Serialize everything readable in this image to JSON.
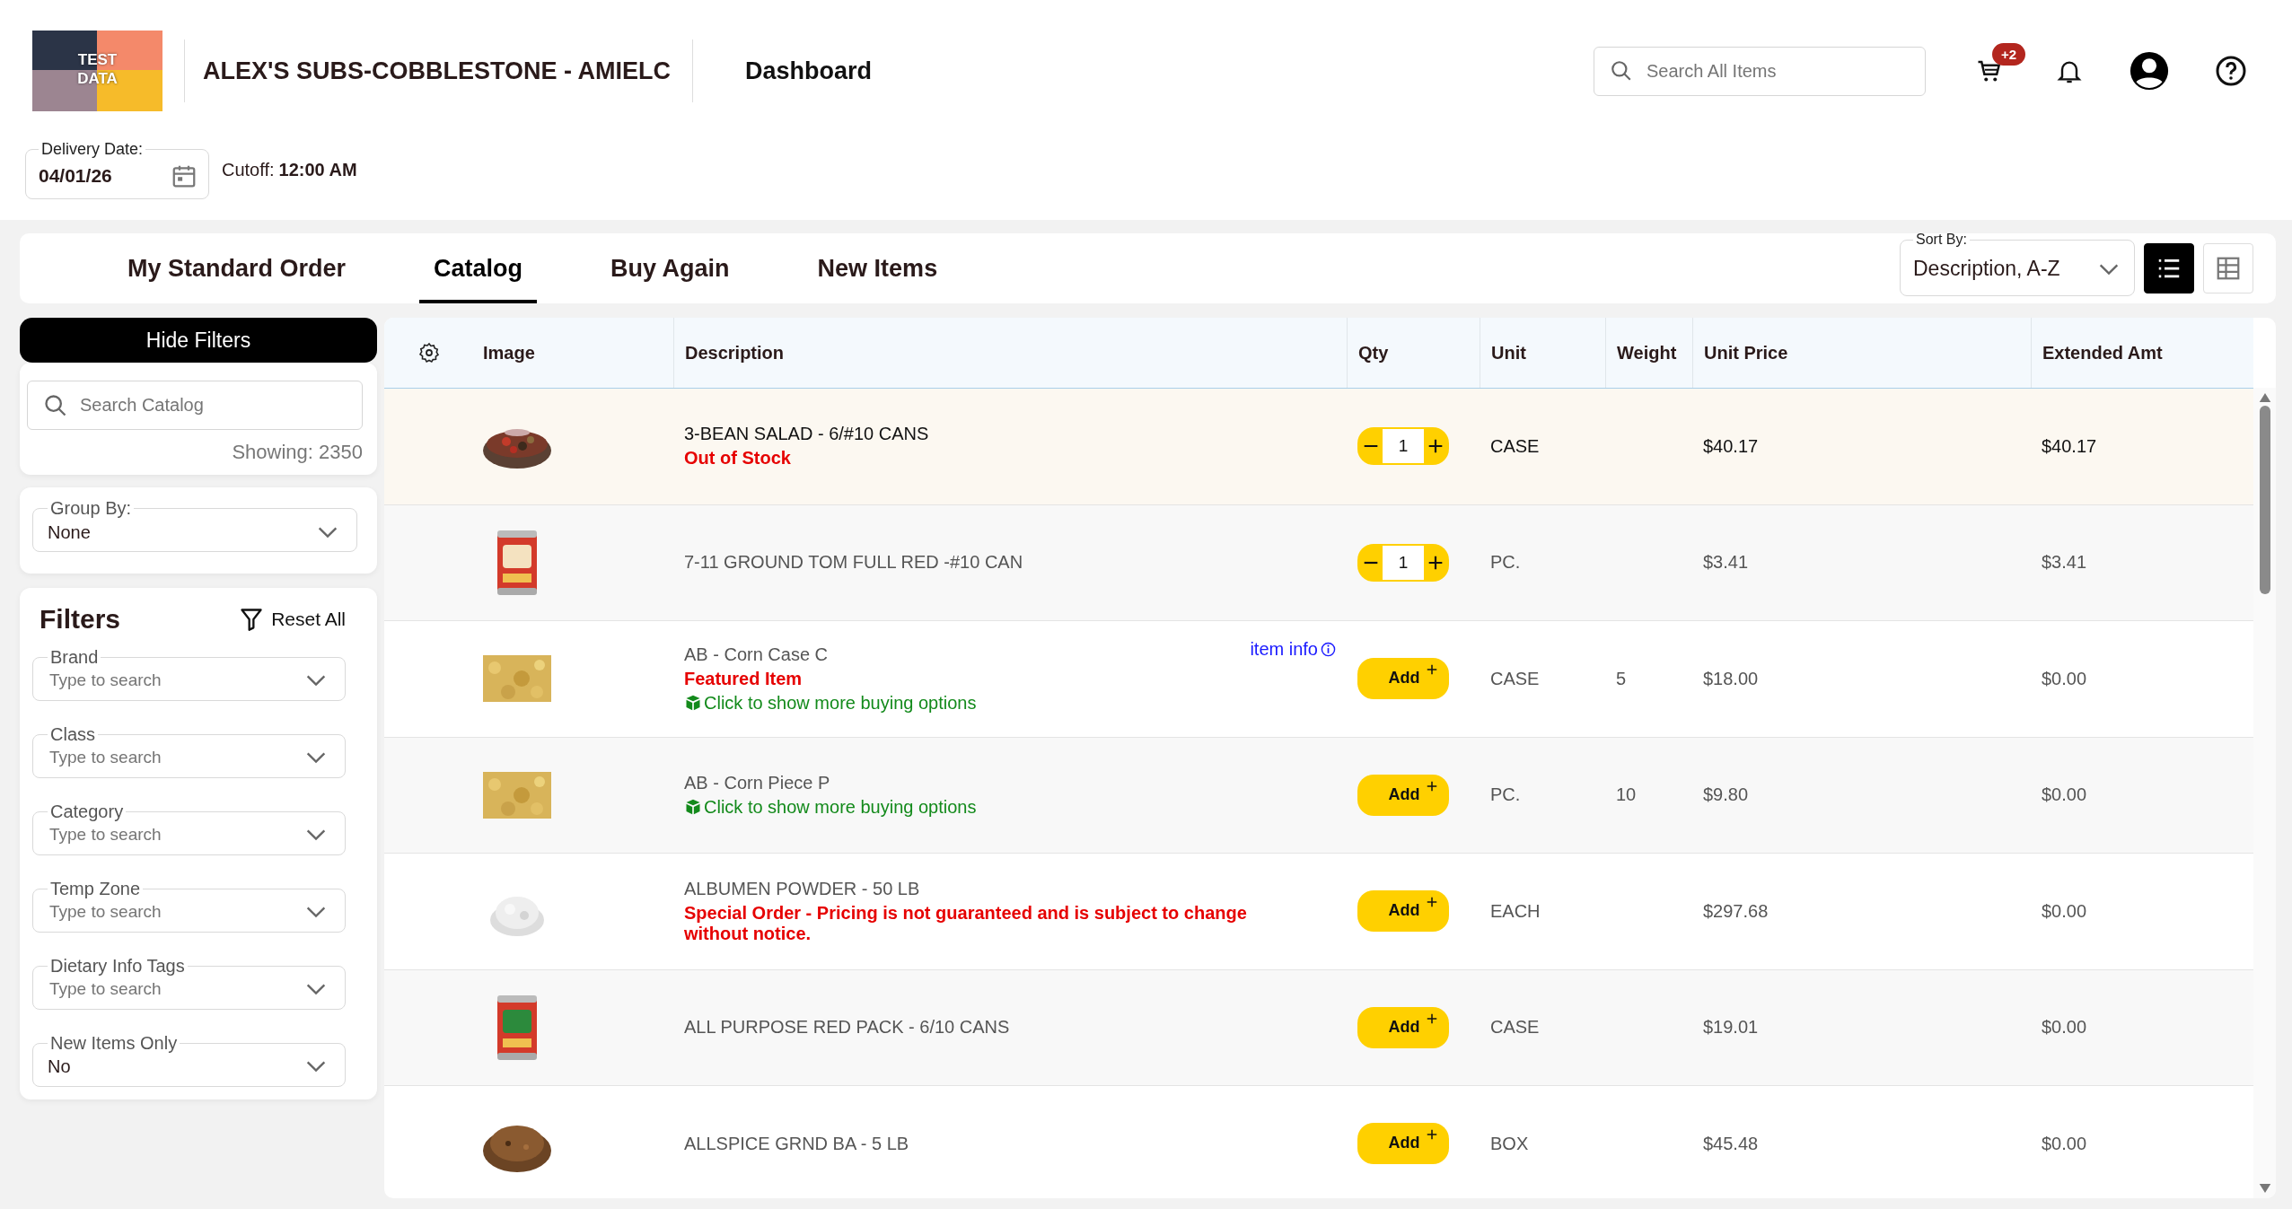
{
  "header": {
    "logo_lines": [
      "TEST",
      "DATA"
    ],
    "store": "ALEX'S SUBS-COBBLESTONE - AMIELC",
    "nav_link": "Dashboard",
    "search": {
      "placeholder": "Search All Items"
    },
    "cart_badge": "+2"
  },
  "delivery": {
    "label": "Delivery Date:",
    "value": "04/01/26",
    "cutoff_label": "Cutoff:",
    "cutoff_value": "12:00 AM"
  },
  "tabs": [
    {
      "label": "My Standard Order",
      "selected": false
    },
    {
      "label": "Catalog",
      "selected": true
    },
    {
      "label": "Buy Again",
      "selected": false
    },
    {
      "label": "New Items",
      "selected": false
    }
  ],
  "sort": {
    "label": "Sort By:",
    "value": "Description, A-Z"
  },
  "view_modes": [
    {
      "kind": "list",
      "selected": true
    },
    {
      "kind": "grid",
      "selected": false
    }
  ],
  "sidebar": {
    "hide_button": "Hide Filters",
    "search": {
      "placeholder": "Search Catalog"
    },
    "showing": "Showing: 2350",
    "group_by": {
      "label": "Group By:",
      "value": "None"
    },
    "filters_title": "Filters",
    "reset": "Reset All",
    "filters": [
      {
        "label": "Brand",
        "placeholder": "Type to search"
      },
      {
        "label": "Class",
        "placeholder": "Type to search"
      },
      {
        "label": "Category",
        "placeholder": "Type to search"
      },
      {
        "label": "Temp Zone",
        "placeholder": "Type to search"
      },
      {
        "label": "Dietary Info Tags",
        "placeholder": "Type to search"
      },
      {
        "label": "New Items Only",
        "value": "No"
      }
    ]
  },
  "table": {
    "columns": [
      "Image",
      "Description",
      "Qty",
      "Unit",
      "Weight",
      "Unit Price",
      "Extended Amt"
    ],
    "rows": [
      {
        "description": "3-BEAN SALAD - 6/#10 CANS",
        "notes": [
          {
            "kind": "alert",
            "text": "Out of Stock"
          }
        ],
        "qty": {
          "kind": "stepper",
          "value": "1"
        },
        "unit": "CASE",
        "unit_price": "$40.17",
        "extended": "$40.17",
        "highlighted": true
      },
      {
        "description": "7-11 GROUND TOM FULL RED -#10 CAN",
        "qty": {
          "kind": "stepper",
          "value": "1"
        },
        "unit": "PC.",
        "unit_price": "$3.41",
        "extended": "$3.41",
        "highlighted": false
      },
      {
        "description": "AB - Corn Case C",
        "info_link": "item info",
        "notes": [
          {
            "kind": "alert",
            "text": "Featured Item"
          },
          {
            "kind": "option",
            "text": "Click to show more buying options"
          }
        ],
        "qty": {
          "kind": "add",
          "label": "Add"
        },
        "unit": "CASE",
        "weight": "5",
        "unit_price": "$18.00",
        "extended": "$0.00",
        "highlighted": false
      },
      {
        "description": "AB - Corn Piece P",
        "notes": [
          {
            "kind": "option",
            "text": "Click to show more buying options"
          }
        ],
        "qty": {
          "kind": "add",
          "label": "Add"
        },
        "unit": "PC.",
        "weight": "10",
        "unit_price": "$9.80",
        "extended": "$0.00",
        "highlighted": false
      },
      {
        "description": "ALBUMEN POWDER - 50 LB",
        "notes": [
          {
            "kind": "alert",
            "text": "Special Order - Pricing is not guaranteed and is subject to change without notice."
          }
        ],
        "qty": {
          "kind": "add",
          "label": "Add"
        },
        "unit": "EACH",
        "unit_price": "$297.68",
        "extended": "$0.00",
        "highlighted": false
      },
      {
        "description": "ALL PURPOSE RED PACK - 6/10 CANS",
        "qty": {
          "kind": "add",
          "label": "Add"
        },
        "unit": "CASE",
        "unit_price": "$19.01",
        "extended": "$0.00",
        "highlighted": false
      },
      {
        "description": "ALLSPICE GRND BA - 5 LB",
        "qty": {
          "kind": "add",
          "label": "Add"
        },
        "unit": "BOX",
        "unit_price": "$45.48",
        "extended": "$0.00",
        "highlighted": false
      }
    ]
  }
}
